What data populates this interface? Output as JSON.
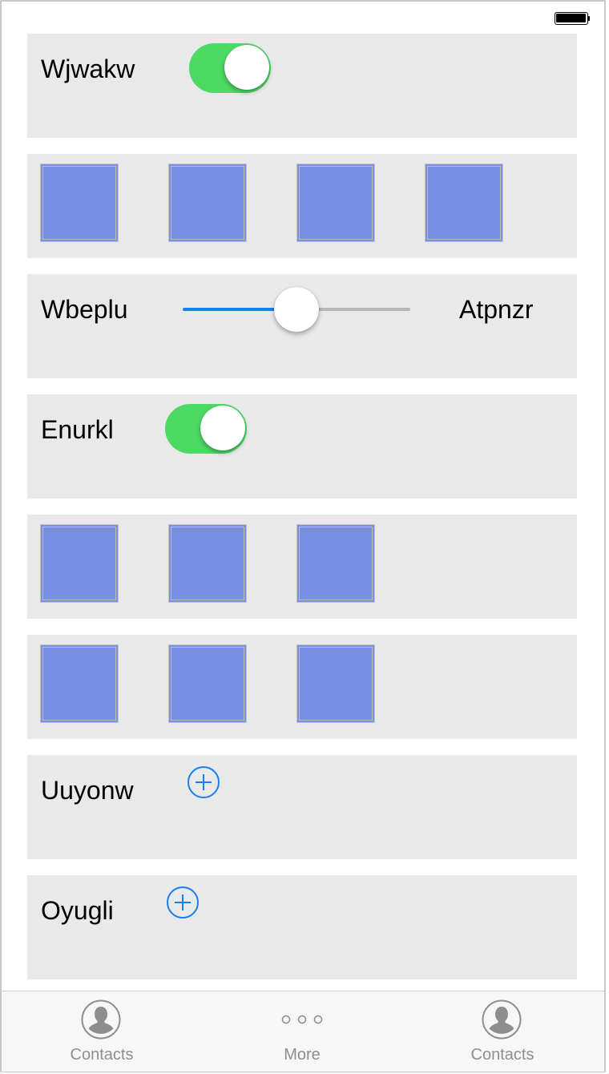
{
  "rows": {
    "toggle1": {
      "label": "Wjwakw",
      "on": true
    },
    "slider": {
      "label": "Wbeplu",
      "right_label": "Atpnzr",
      "value": 0.5
    },
    "toggle2": {
      "label": "Enurkl",
      "on": true
    },
    "add1": {
      "label": "Uuyonw",
      "icon": "plus-circle-icon"
    },
    "add2": {
      "label": "Oyugli",
      "icon": "plus-circle-icon"
    }
  },
  "colors": {
    "toggle_on": "#4cd964",
    "accent": "#1a7ef0",
    "tile": "#7a91e3",
    "row_bg": "#e9e9e9"
  },
  "tabbar": {
    "tabs": [
      {
        "label": "Contacts",
        "icon": "contact-icon"
      },
      {
        "label": "More",
        "icon": "more-icon"
      },
      {
        "label": "Contacts",
        "icon": "contact-icon"
      }
    ]
  }
}
